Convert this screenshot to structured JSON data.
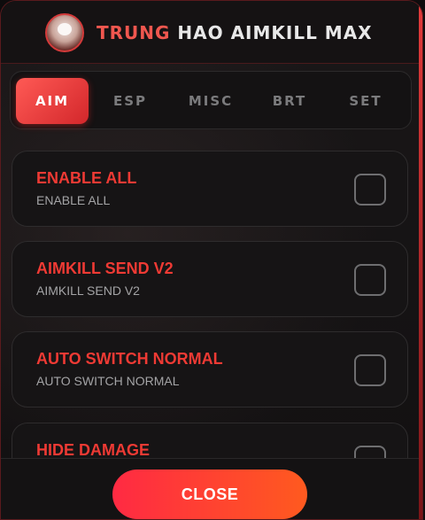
{
  "header": {
    "title_accent": "TRUNG",
    "title_rest": " HAO AIMKILL MAX"
  },
  "tabs": [
    {
      "label": "AIM",
      "active": true
    },
    {
      "label": "ESP",
      "active": false
    },
    {
      "label": "MISC",
      "active": false
    },
    {
      "label": "BRT",
      "active": false
    },
    {
      "label": "SET",
      "active": false
    }
  ],
  "options": [
    {
      "title": "ENABLE ALL",
      "subtitle": "ENABLE ALL",
      "checked": false
    },
    {
      "title": "AIMKILL SEND V2",
      "subtitle": "AIMKILL SEND V2",
      "checked": false
    },
    {
      "title": "AUTO SWITCH NORMAL",
      "subtitle": "AUTO SWITCH NORMAL",
      "checked": false
    },
    {
      "title": "HIDE DAMAGE",
      "subtitle": "",
      "checked": false
    }
  ],
  "footer": {
    "close_label": "CLOSE"
  },
  "colors": {
    "accent": "#ef3a34",
    "close_gradient_start": "#ff2a43",
    "close_gradient_end": "#ff5a1f"
  }
}
